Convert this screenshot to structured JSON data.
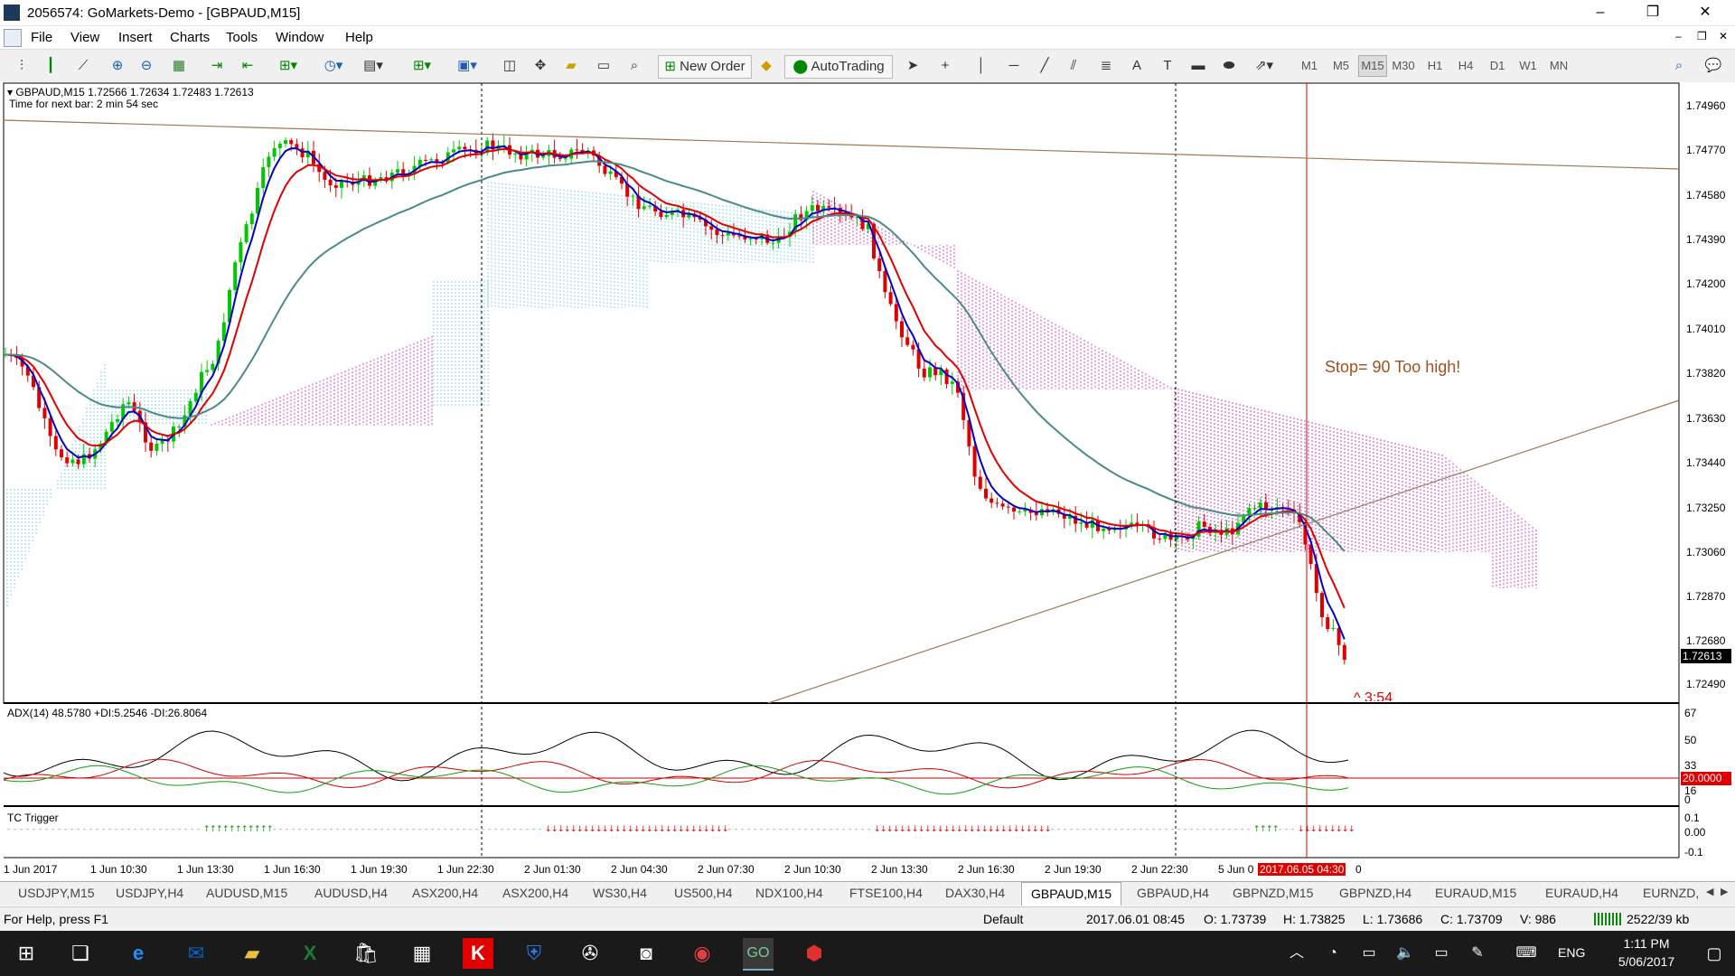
{
  "window": {
    "title": "2056574: GoMarkets-Demo - [GBPAUD,M15]",
    "controls": {
      "minimize": "–",
      "restore": "❐",
      "close": "✕"
    }
  },
  "menu": [
    "File",
    "View",
    "Insert",
    "Charts",
    "Tools",
    "Window",
    "Help"
  ],
  "toolbar": {
    "new_order": "New Order",
    "autotrading": "AutoTrading",
    "timeframes": [
      "M1",
      "M5",
      "M15",
      "M30",
      "H1",
      "H4",
      "D1",
      "W1",
      "MN"
    ],
    "active_timeframe": "M15"
  },
  "chart": {
    "header": "GBPAUD,M15  1.72566 1.72634 1.72483 1.72613",
    "timer": "Time for next bar: 2 min 54 sec",
    "annotation": "Stop= 90 Too high!",
    "price_labels": [
      "1.74960",
      "1.74770",
      "1.74580",
      "1.74390",
      "1.74200",
      "1.74010",
      "1.73820",
      "1.73630",
      "1.73440",
      "1.73250",
      "1.73060",
      "1.72870",
      "1.72680",
      "1.72490"
    ],
    "current_price": "1.72613",
    "partial_text": "^ 3:54",
    "adx_header": "ADX(14) 48.5780 +DI:5.2546 -DI:26.8064",
    "adx_scale": [
      "67",
      "50",
      "33",
      "16",
      "0"
    ],
    "adx_level": "20.0000",
    "tc_header": "TC Trigger",
    "tc_scale": [
      "0.1",
      "0.00",
      "-0.1"
    ],
    "time_labels": [
      "1 Jun 2017",
      "1 Jun 10:30",
      "1 Jun 13:30",
      "1 Jun 16:30",
      "1 Jun 19:30",
      "1 Jun 22:30",
      "2 Jun 01:30",
      "2 Jun 04:30",
      "2 Jun 07:30",
      "2 Jun 10:30",
      "2 Jun 13:30",
      "2 Jun 16:30",
      "2 Jun 19:30",
      "2 Jun 22:30",
      "5 Jun 0"
    ],
    "cursor_time": "2017.06.05 04:30",
    "cursor_time_suffix": "0",
    "colors": {
      "bull": "#00c800",
      "bear": "#e00000",
      "fast_ma": "#e00000",
      "blue_ma": "#0000c8",
      "slow_ma": "#4a8a8a",
      "cloud_up": "#7fd0e0",
      "cloud_down": "#d040c0",
      "trendline": "#a07850"
    }
  },
  "tabs": [
    "USDJPY,M15",
    "USDJPY,H4",
    "AUDUSD,M15",
    "AUDUSD,H4",
    "ASX200,H4",
    "ASX200,H4",
    "WS30,H4",
    "US500,H4",
    "NDX100,H4",
    "FTSE100,H4",
    "DAX30,H4",
    "GBPAUD,M15",
    "GBPAUD,H4",
    "GBPNZD,M15",
    "GBPNZD,H4",
    "EURAUD,M15",
    "EURAUD,H4",
    "EURNZD,"
  ],
  "active_tab": "GBPAUD,M15",
  "status": {
    "help": "For Help, press F1",
    "profile": "Default",
    "datetime": "2017.06.01 08:45",
    "open": "O: 1.73739",
    "high": "H: 1.73825",
    "low": "L: 1.73686",
    "close": "C: 1.73709",
    "volume": "V: 986",
    "traffic": "2522/39 kb"
  },
  "taskbar": {
    "language": "ENG",
    "time": "1:11 PM",
    "date": "5/06/2017"
  }
}
